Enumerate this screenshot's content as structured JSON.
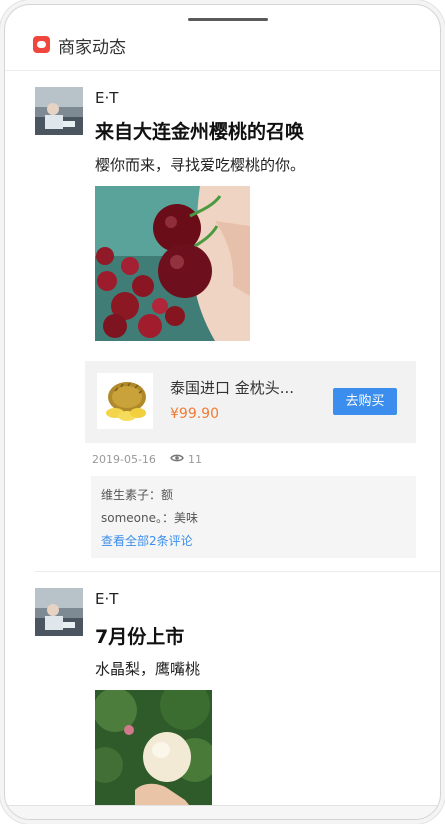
{
  "header": {
    "title": "商家动态",
    "icon": "chat-bubble-icon"
  },
  "posts": [
    {
      "author": "E·T",
      "title": "来自大连金州樱桃的召唤",
      "description": "樱你而来，寻找爱吃樱桃的你。",
      "photo": "cherries-in-hand",
      "product": {
        "name": "泰国进口 金枕头...",
        "price": "¥99.90",
        "buy_label": "去购买",
        "thumb": "durian-image"
      },
      "date": "2019-05-16",
      "views": "11",
      "comments": [
        {
          "text": "维生素子：额"
        },
        {
          "text": "someone。：美味"
        }
      ],
      "view_all_label": "查看全部2条评论"
    },
    {
      "author": "E·T",
      "title": "7月份上市",
      "description": "水晶梨，鹰嘴桃",
      "photo": "bagged-pear-in-hand"
    }
  ],
  "colors": {
    "accent": "#3b8eed",
    "price": "#f07b34",
    "header_icon": "#f0463e"
  }
}
